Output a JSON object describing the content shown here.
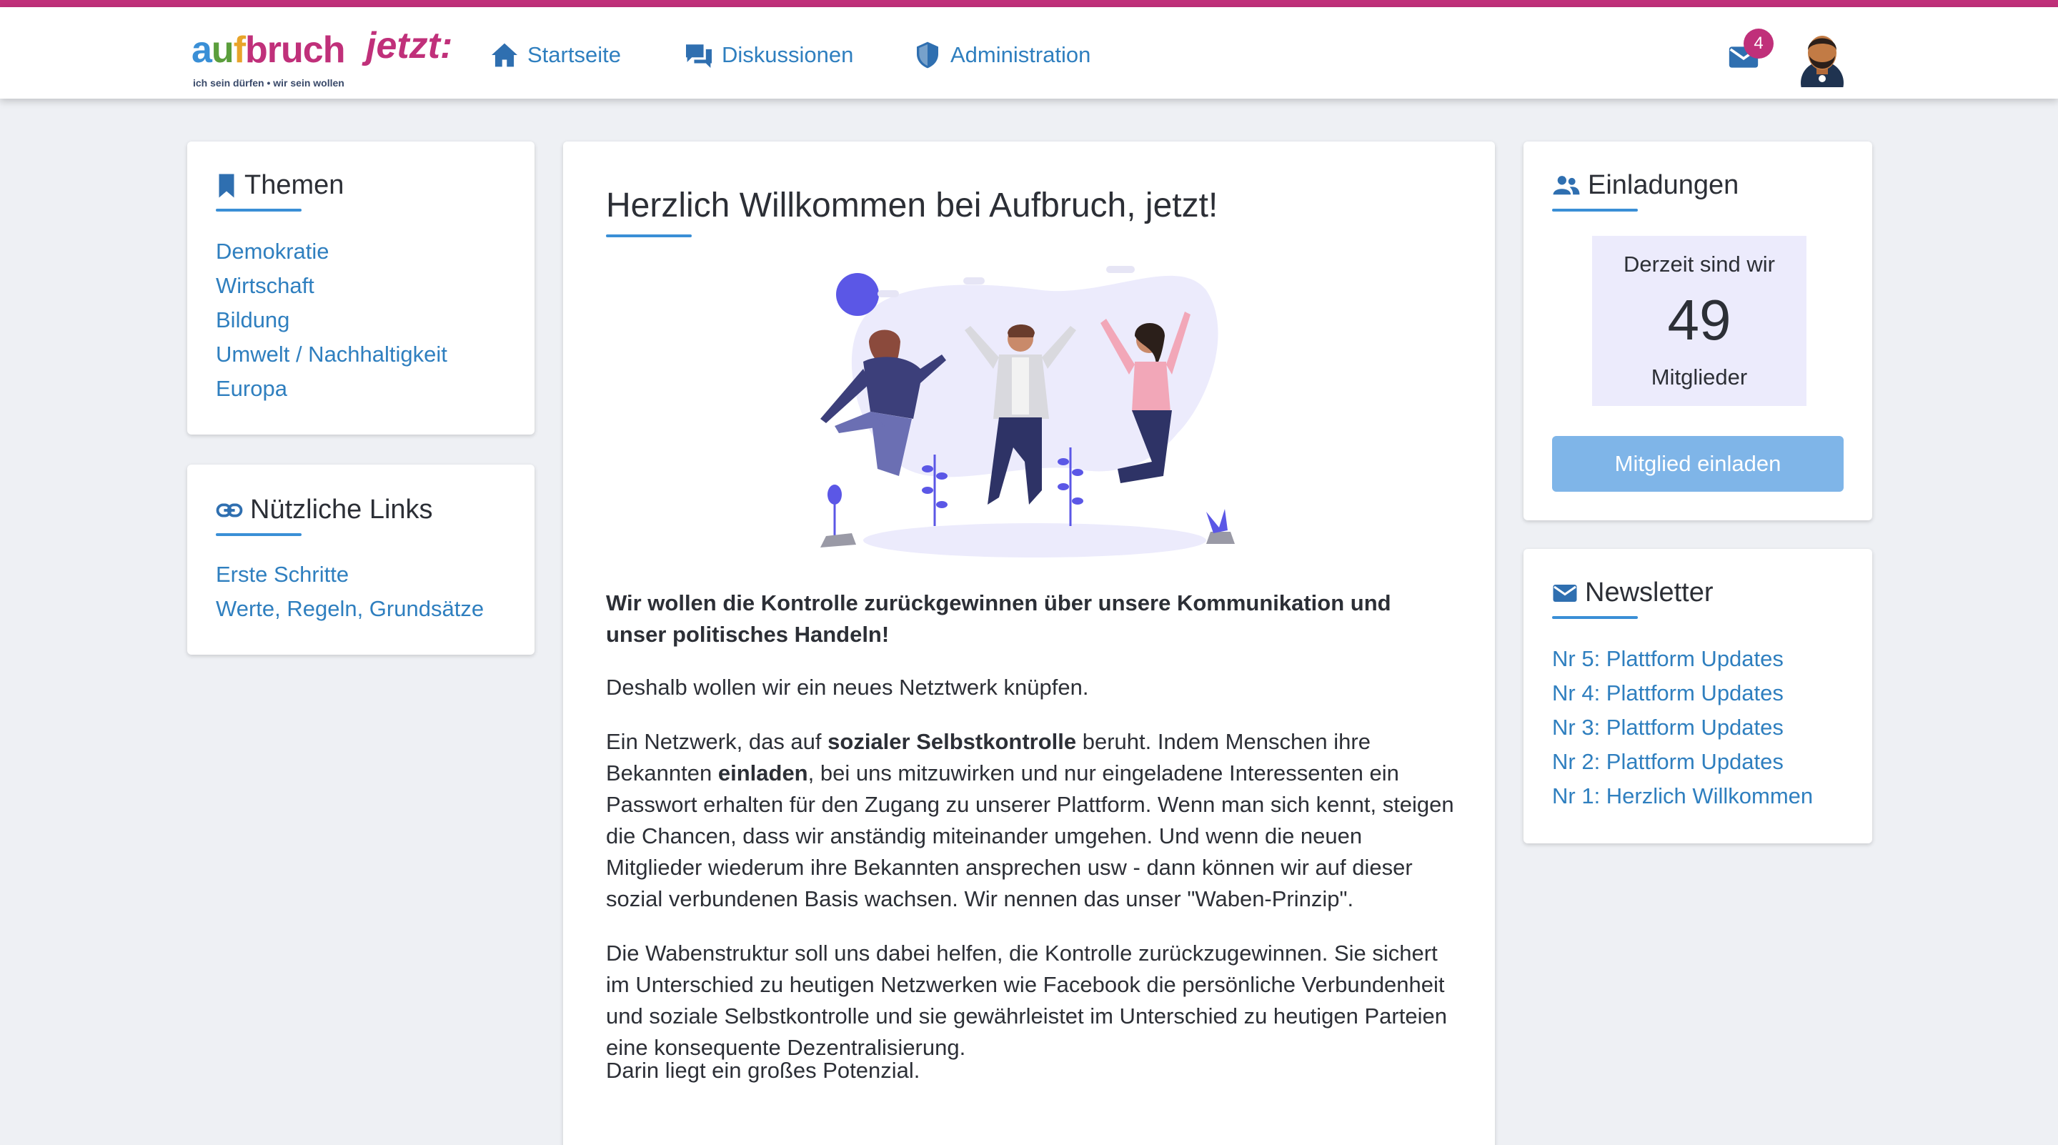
{
  "brand": {
    "word_a": "a",
    "word_u": "u",
    "word_f": "f",
    "word_rest": "bruch",
    "word_jetzt": "jetzt:",
    "tagline": "ich sein dürfen • wir sein wollen",
    "accent": "#c0307a",
    "primary": "#3a8fd6"
  },
  "nav": {
    "home": {
      "label": "Startseite",
      "icon": "home-icon"
    },
    "discussions": {
      "label": "Diskussionen",
      "icon": "chat-icon"
    },
    "admin": {
      "label": "Administration",
      "icon": "shield-icon"
    },
    "mail_badge": "4"
  },
  "themes": {
    "title": "Themen",
    "icon": "bookmark-icon",
    "items": [
      "Demokratie",
      "Wirtschaft",
      "Bildung",
      "Umwelt / Nachhaltigkeit",
      "Europa"
    ]
  },
  "links": {
    "title": "Nützliche Links",
    "icon": "link-icon",
    "items": [
      "Erste Schritte",
      "Werte, Regeln, Grundsätze"
    ]
  },
  "main": {
    "title": "Herzlich Willkommen bei Aufbruch, jetzt!",
    "lead": "Wir wollen die Kontrolle zurückgewinnen über unsere Kommunikation und unser politisches Handeln!",
    "p1": "Deshalb wollen wir ein neues Netztwerk knüpfen.",
    "p2_a": "Ein Netzwerk, das auf ",
    "p2_b": "sozialer Selbstkontrolle",
    "p2_c": " beruht. Indem Menschen ihre Bekannten ",
    "p2_d": "einladen",
    "p2_e": ", bei uns mitzuwirken und nur eingeladene Interessenten ein Passwort erhalten für den Zugang zu unserer Plattform. Wenn man sich kennt, steigen die Chancen, dass wir anständig miteinander umgehen. Und wenn die neuen Mitglieder wiederum ihre Bekannten ansprechen usw - dann können wir auf dieser sozial verbundenen Basis wachsen. Wir nennen das unser \"Waben-Prinzip\".",
    "p3": "Die Wabenstruktur soll uns dabei helfen, die Kontrolle zurückzugewinnen. Sie sichert im Unterschied zu heutigen Netzwerken wie Facebook die persönliche Verbundenheit und soziale Selbstkontrolle und sie gewährleistet im Unterschied zu heutigen Parteien eine konsequente Dezentralisierung.",
    "p4": "Darin liegt ein großes Potenzial."
  },
  "invitations": {
    "title": "Einladungen",
    "icon": "users-icon",
    "line1": "Derzeit sind wir",
    "count": "49",
    "line3": "Mitglieder",
    "button": "Mitglied einladen"
  },
  "newsletter": {
    "title": "Newsletter",
    "icon": "mail-icon",
    "items": [
      "Nr 5: Plattform Updates",
      "Nr 4: Plattform Updates",
      "Nr 3: Plattform Updates",
      "Nr 2: Plattform Updates",
      "Nr 1: Herzlich Willkommen"
    ]
  }
}
